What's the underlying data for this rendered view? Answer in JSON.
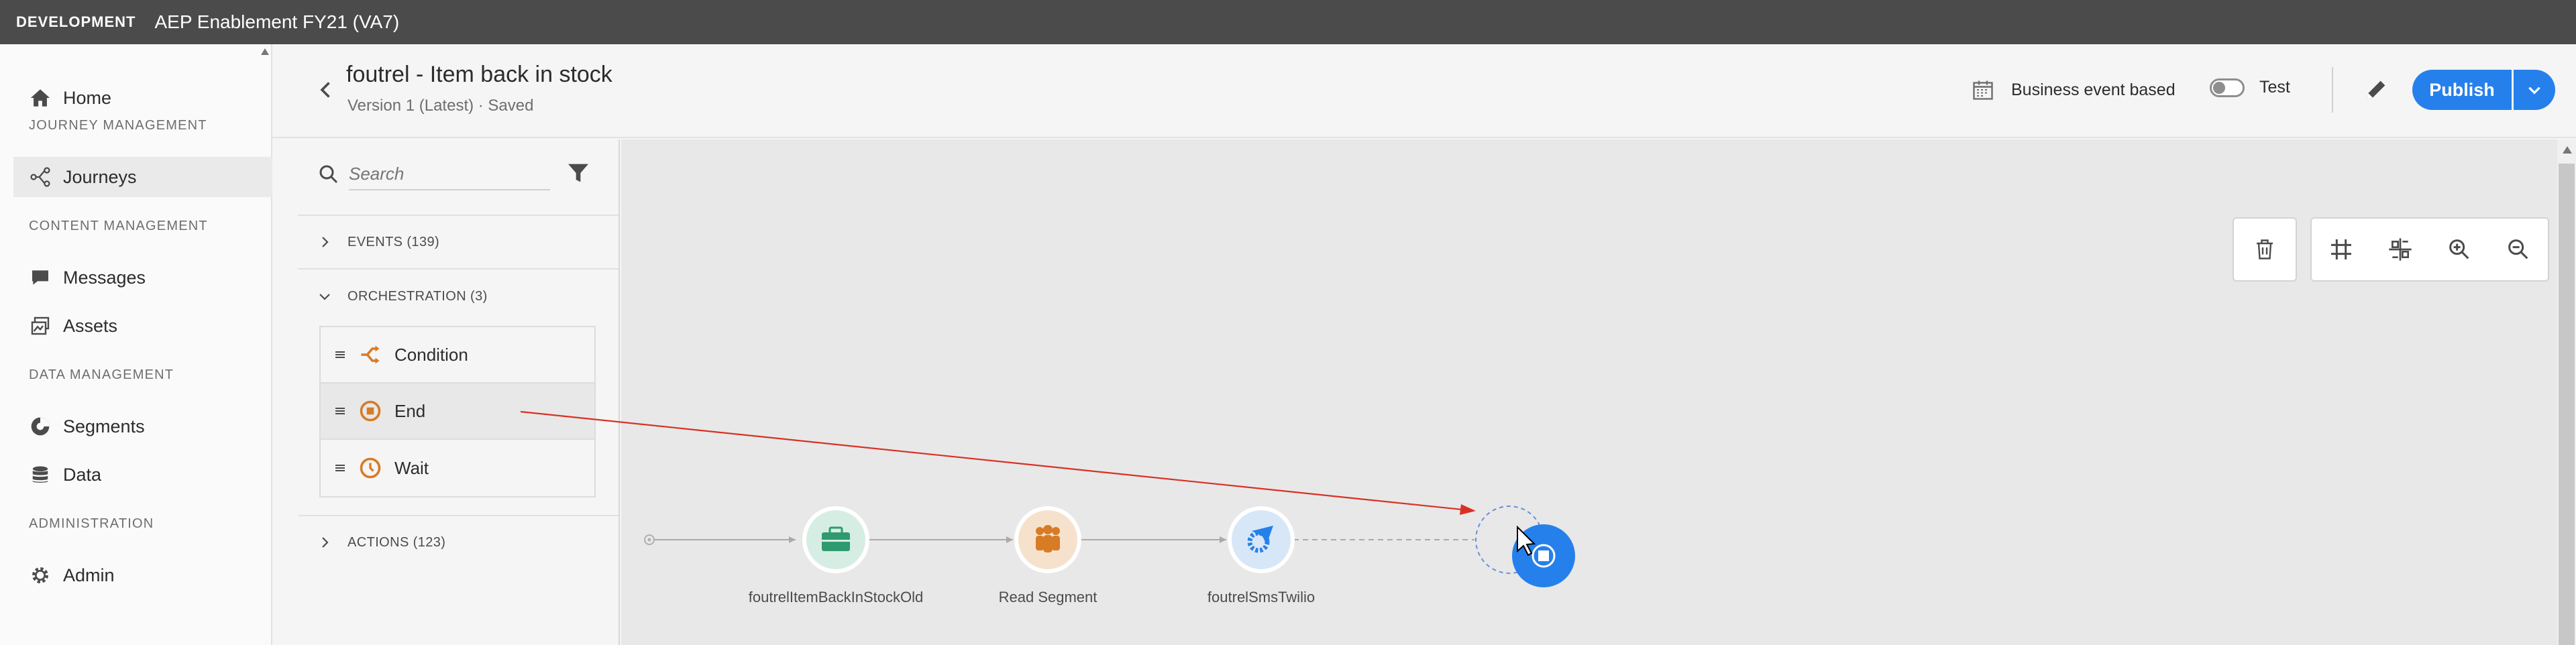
{
  "topbar": {
    "environment": "DEVELOPMENT",
    "org": "AEP Enablement FY21 (VA7)"
  },
  "nav": {
    "home": "Home",
    "heading_journey": "JOURNEY MANAGEMENT",
    "journeys": "Journeys",
    "heading_content": "CONTENT MANAGEMENT",
    "messages": "Messages",
    "assets": "Assets",
    "heading_data": "DATA MANAGEMENT",
    "segments": "Segments",
    "data": "Data",
    "heading_admin": "ADMINISTRATION",
    "admin": "Admin"
  },
  "header": {
    "title": "foutrel - Item back in stock",
    "subtitle": "Version 1 (Latest) · Saved",
    "business_event": "Business event based",
    "test_label": "Test",
    "publish_label": "Publish"
  },
  "palette": {
    "search_placeholder": "Search",
    "events": "EVENTS (139)",
    "orchestration": "ORCHESTRATION (3)",
    "orch_items": [
      "Condition",
      "End",
      "Wait"
    ],
    "actions": "ACTIONS (123)"
  },
  "canvas": {
    "nodes": [
      {
        "label": "foutrelItemBackInStockOld",
        "icon": "briefcase-icon"
      },
      {
        "label": "Read Segment",
        "icon": "people-icon"
      },
      {
        "label": "foutrelSmsTwilio",
        "icon": "gear-send-icon"
      }
    ]
  },
  "colors": {
    "accent": "#2680eb",
    "topbar": "#4b4b4b",
    "orange": "#d87b25",
    "event_node_bg": "#d6ede4",
    "event_node_fg": "#2f9a6f",
    "segment_node_bg": "#f6e2cc",
    "action_node_bg": "#d7e7f8",
    "drag_arrow": "#d93025"
  }
}
